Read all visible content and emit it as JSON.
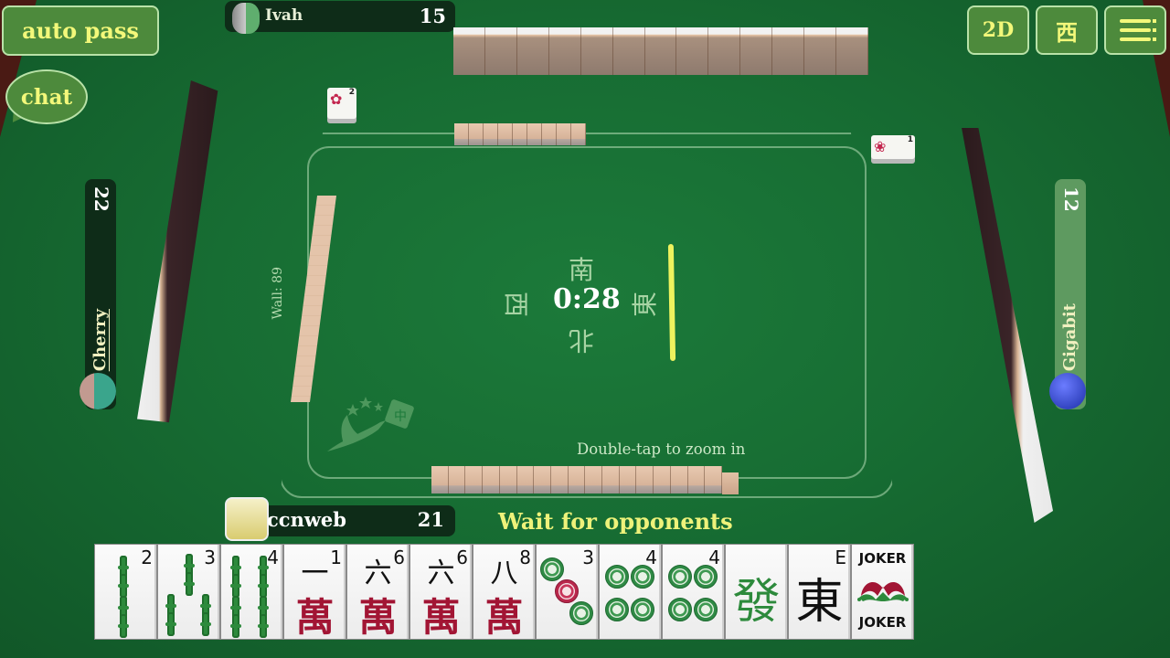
{
  "toolbar": {
    "auto_pass_label": "auto pass",
    "chat_label": "chat",
    "view_mode_label": "2D",
    "seat_wind_label": "西",
    "menu_icon": "menu-icon"
  },
  "players": {
    "north": {
      "name": "Ivah",
      "tile_count": "15"
    },
    "west": {
      "name": "Cherry",
      "tile_count": "22"
    },
    "east": {
      "name": "Gigabit",
      "tile_count": "12"
    },
    "south": {
      "name": "ccnweb",
      "tile_count": "21"
    }
  },
  "table": {
    "wall_label": "Wall: 89",
    "timer": "0:28",
    "winds": {
      "south": "南",
      "north": "北",
      "west": "西",
      "east": "東"
    },
    "zoom_hint": "Double-tap to zoom in",
    "status": "Wait for opponents",
    "flowers": {
      "north": {
        "number": "2",
        "icon": "✿"
      },
      "east": {
        "number": "1",
        "icon": "❀"
      }
    },
    "colors": {
      "felt": "#176d33",
      "accent": "#f3f87a",
      "turn_indicator": "#eef25e"
    }
  },
  "hand": [
    {
      "suit": "bamboo",
      "rank": "2"
    },
    {
      "suit": "bamboo",
      "rank": "3"
    },
    {
      "suit": "bamboo",
      "rank": "4"
    },
    {
      "suit": "character",
      "rank": "1",
      "top": "一",
      "bottom": "萬"
    },
    {
      "suit": "character",
      "rank": "6",
      "top": "六",
      "bottom": "萬"
    },
    {
      "suit": "character",
      "rank": "6",
      "top": "六",
      "bottom": "萬"
    },
    {
      "suit": "character",
      "rank": "8",
      "top": "八",
      "bottom": "萬"
    },
    {
      "suit": "dots",
      "rank": "3"
    },
    {
      "suit": "dots",
      "rank": "4"
    },
    {
      "suit": "dots",
      "rank": "4"
    },
    {
      "suit": "dragon",
      "glyph": "發",
      "color": "#2d8a3c"
    },
    {
      "suit": "wind",
      "glyph": "東",
      "corner": "E",
      "color": "#111111"
    },
    {
      "suit": "joker",
      "top": "JOKER",
      "bottom": "JOKER"
    }
  ]
}
